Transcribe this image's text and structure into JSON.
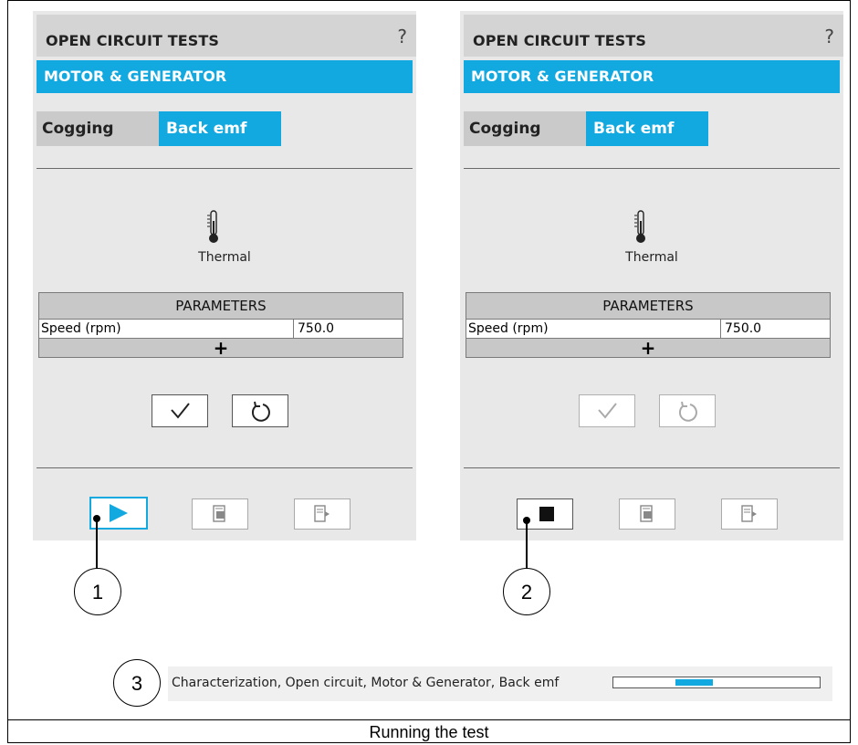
{
  "panels": [
    {
      "header_title": "OPEN CIRCUIT TESTS",
      "help_label": "?",
      "section_title": "MOTOR & GENERATOR",
      "tabs": [
        "Cogging",
        "Back emf"
      ],
      "active_tab": "Back emf",
      "mode_label": "Thermal",
      "params_header": "PARAMETERS",
      "param_rows": [
        {
          "name": "Speed (rpm)",
          "value": "750.0"
        }
      ],
      "add_label": "+",
      "run_state": "idle"
    },
    {
      "header_title": "OPEN CIRCUIT TESTS",
      "help_label": "?",
      "section_title": "MOTOR & GENERATOR",
      "tabs": [
        "Cogging",
        "Back emf"
      ],
      "active_tab": "Back emf",
      "mode_label": "Thermal",
      "params_header": "PARAMETERS",
      "param_rows": [
        {
          "name": "Speed (rpm)",
          "value": "750.0"
        }
      ],
      "add_label": "+",
      "run_state": "running"
    }
  ],
  "callouts": [
    "1",
    "2",
    "3"
  ],
  "statusbar": {
    "text": "Characterization, Open circuit, Motor & Generator, Back emf",
    "progress_segment": [
      0.3,
      0.48
    ]
  },
  "caption": "Running the test",
  "icons": {
    "help": "question-mark-icon",
    "mode": "thermometer-icon",
    "ok": "checkmark-icon",
    "reset": "reset-icon",
    "play": "play-icon",
    "stop": "stop-icon",
    "report": "report-icon",
    "export": "export-icon"
  },
  "colors": {
    "accent": "#12a8e0",
    "panel": "#e8e8e8",
    "header": "#d4d4d4",
    "tab_inactive": "#cacaca"
  }
}
